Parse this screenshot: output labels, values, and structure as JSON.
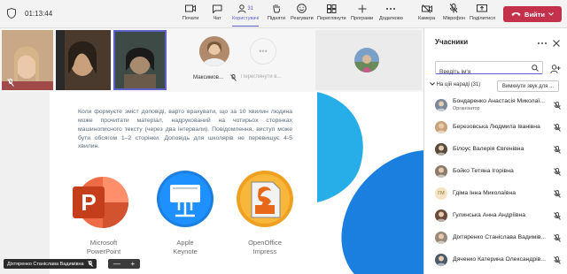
{
  "meeting": {
    "timer": "01:13:44"
  },
  "toolbar": {
    "items": [
      {
        "label": "Почати"
      },
      {
        "label": "Чат"
      },
      {
        "label": "Користувачі",
        "count": "31"
      },
      {
        "label": "Підняти"
      },
      {
        "label": "Реагувати"
      },
      {
        "label": "Переглянути"
      },
      {
        "label": "Програми"
      },
      {
        "label": "Додатково"
      },
      {
        "label": "Камера"
      },
      {
        "label": "Мікрофон"
      },
      {
        "label": "Поділитися"
      }
    ],
    "leave_label": "Вийти"
  },
  "stage": {
    "thumb_name_1": "Максимов...",
    "thumb_name_2": "Переглянути в...",
    "slide": {
      "text": "Коли формуєте зміст доповіді, варто врахувати, що за 10 хвилин людина може прочитати матеріал, надрукований на чотирьох сторінках машинописного тексту (через два інтервали). Повідомлення, виступ може бути обсягом 1–2 сторінки. Доповідь для школярів не перевищує 4-5 хвилин.",
      "apps": [
        {
          "line1": "Microsoft",
          "line2": "PowerPoint"
        },
        {
          "line1": "Apple",
          "line2": "Keynote"
        },
        {
          "line1": "OpenOffice",
          "line2": "Impress"
        }
      ]
    },
    "presenter_name": "Діхтяренко Станіслава Вадимівна",
    "zoom_minus": "—",
    "zoom_plus": "+"
  },
  "panel": {
    "title": "Учасники",
    "search_placeholder": "Введіть ім'я",
    "section_label": "На цій нараді (31)",
    "mute_all_label": "Вимкнути звук для ...",
    "participants": [
      {
        "name": "Бондаренко Анастасія Миколаї...",
        "role": "Організатор",
        "initials": "",
        "avatar_color": "#7a8a9a"
      },
      {
        "name": "Березовська Людмила Іванівна",
        "role": "",
        "initials": "",
        "avatar_color": "#c9a27a"
      },
      {
        "name": "Білоус Валерія Євгенівна",
        "role": "",
        "initials": "",
        "avatar_color": "#5a4a3a"
      },
      {
        "name": "Бойко Тетяна Ігорівна",
        "role": "",
        "initials": "",
        "avatar_color": "#8c7a6a"
      },
      {
        "name": "Гдіма Інна Миколаївна",
        "role": "",
        "initials": "ГМ",
        "avatar_color": "#f4e4c4"
      },
      {
        "name": "Гулинська Анна Андріївна",
        "role": "",
        "initials": "",
        "avatar_color": "#6a4a3a"
      },
      {
        "name": "Діхтяренко Станіслава Вадимів...",
        "role": "",
        "initials": "",
        "avatar_color": "#9a8a7a"
      },
      {
        "name": "Дяченко Катерина Олександрів...",
        "role": "",
        "initials": "",
        "avatar_color": "#4a5a6a"
      }
    ]
  },
  "colors": {
    "accent": "#5b5fc7",
    "leave": "#c4314b",
    "slide_blue": "#1b7fe0",
    "slide_cyan": "#27aee8"
  }
}
